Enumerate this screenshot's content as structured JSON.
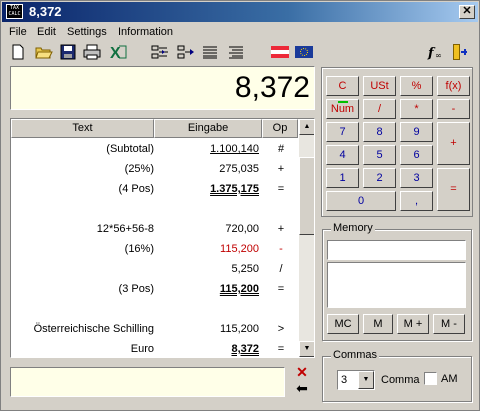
{
  "window": {
    "title": "8,372",
    "app_icon_text": [
      "TAX",
      "CALC"
    ]
  },
  "menu": [
    "File",
    "Edit",
    "Settings",
    "Information"
  ],
  "toolbar": {
    "icons": [
      "new-icon",
      "open-icon",
      "save-icon",
      "print-icon",
      "excel-icon",
      "indent-left-icon",
      "indent-right-icon",
      "align-left-icon",
      "align-right-icon",
      "austria-flag-icon",
      "eu-flag-icon",
      "function-icon",
      "exit-icon"
    ]
  },
  "display": {
    "value": "8,372"
  },
  "tape": {
    "headers": [
      "Text",
      "Eingabe",
      "Op"
    ],
    "rows": [
      {
        "text": "(Subtotal)",
        "input": "1.100,140",
        "op": "#",
        "style": "under1"
      },
      {
        "text": "(25%)",
        "input": "275,035",
        "op": "+",
        "style": ""
      },
      {
        "text": "(4 Pos)",
        "input": "1.375,175",
        "op": "=",
        "style": "under2"
      },
      {
        "text": "",
        "input": "",
        "op": "",
        "style": ""
      },
      {
        "text": "12*56+56-8",
        "input": "720,00",
        "op": "+",
        "style": ""
      },
      {
        "text": "(16%)",
        "input": "115,200",
        "op": "-",
        "style": "red"
      },
      {
        "text": "",
        "input": "5,250",
        "op": "/",
        "style": ""
      },
      {
        "text": "(3 Pos)",
        "input": "115,200",
        "op": "=",
        "style": "under2"
      },
      {
        "text": "",
        "input": "",
        "op": "",
        "style": ""
      },
      {
        "text": "Österreichische Schilling",
        "input": "115,200",
        "op": ">",
        "style": ""
      },
      {
        "text": "Euro",
        "input": "8,372",
        "op": "=",
        "style": "under2"
      }
    ]
  },
  "keypad": {
    "row1": [
      "C",
      "USt",
      "%",
      "f(x)"
    ],
    "row2": [
      "Num",
      "/",
      "*",
      "-"
    ],
    "row3": [
      "7",
      "8",
      "9"
    ],
    "row4": [
      "4",
      "5",
      "6"
    ],
    "row5": [
      "1",
      "2",
      "3"
    ],
    "row6": [
      "0",
      ","
    ],
    "plus": "+",
    "equals": "="
  },
  "memory": {
    "title": "Memory",
    "buttons": [
      "MC",
      "M",
      "M +",
      "M -"
    ]
  },
  "commas": {
    "title": "Commas",
    "value": "3",
    "label": "Comma",
    "am_label": "AM",
    "am_checked": false
  },
  "colors": {
    "title_start": "#0a246a",
    "title_end": "#a6caf0",
    "display_bg": "#ffffe8",
    "red_keys": "#c00000",
    "blue_keys": "#0000a0"
  }
}
